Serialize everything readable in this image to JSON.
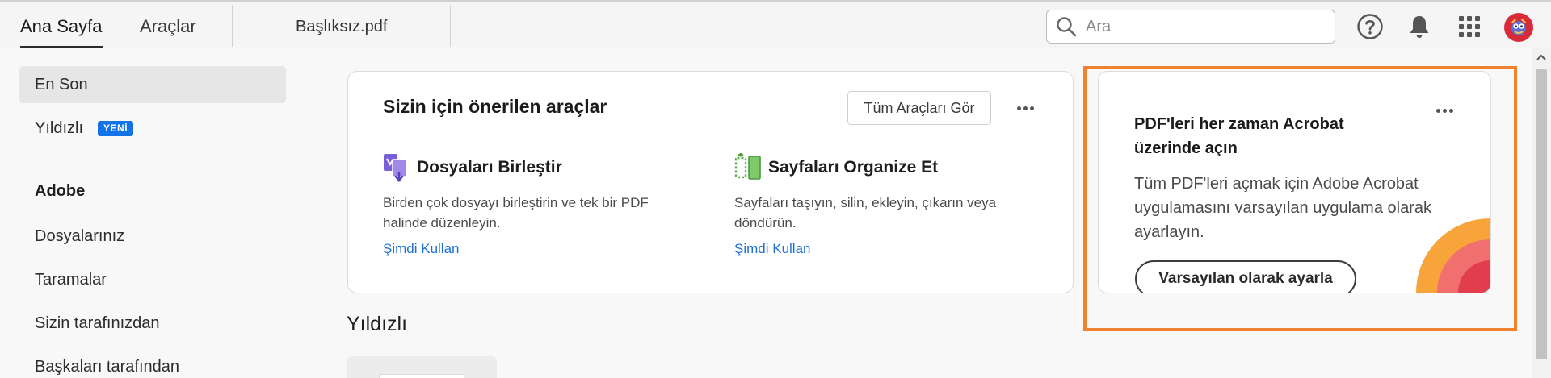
{
  "header": {
    "tabs": [
      {
        "label": "Ana Sayfa"
      },
      {
        "label": "Araçlar"
      }
    ],
    "document_tab": "Başlıksız.pdf",
    "search": {
      "placeholder": "Ara",
      "value": ""
    },
    "icons": [
      "search-icon",
      "help-icon",
      "bell-icon",
      "apps-grid-icon",
      "avatar"
    ]
  },
  "sidebar": {
    "items_top": [
      {
        "label": "En Son",
        "active": true
      },
      {
        "label": "Yıldızlı",
        "badge": "YENİ"
      }
    ],
    "heading": "Adobe",
    "items": [
      {
        "label": "Dosyalarınız"
      },
      {
        "label": "Taramalar"
      },
      {
        "label": "Sizin tarafınızdan"
      },
      {
        "label": "Başkaları tarafından"
      }
    ]
  },
  "recommended": {
    "title": "Sizin için önerilen araçlar",
    "all_tools_button": "Tüm Araçları Gör",
    "tools": [
      {
        "name": "Dosyaları Birleştir",
        "icon": "combine-files-icon",
        "description": "Birden çok dosyayı birleştirin ve tek bir PDF halinde düzenleyin.",
        "link": "Şimdi Kullan"
      },
      {
        "name": "Sayfaları Organize Et",
        "icon": "organize-pages-icon",
        "description": "Sayfaları taşıyın, silin, ekleyin, çıkarın veya döndürün.",
        "link": "Şimdi Kullan"
      }
    ]
  },
  "starred_section": {
    "title": "Yıldızlı"
  },
  "promo": {
    "title": "PDF'leri her zaman Acrobat üzerinde açın",
    "text": "Tüm PDF'leri açmak için Adobe Acrobat uygulamasını varsayılan uygulama olarak ayarlayın.",
    "button": "Varsayılan olarak ayarla"
  },
  "colors": {
    "accent_blue": "#1473e6",
    "link_blue": "#1b6fd8",
    "highlight_orange": "#f0812e",
    "avatar_red": "#d82b3a"
  }
}
